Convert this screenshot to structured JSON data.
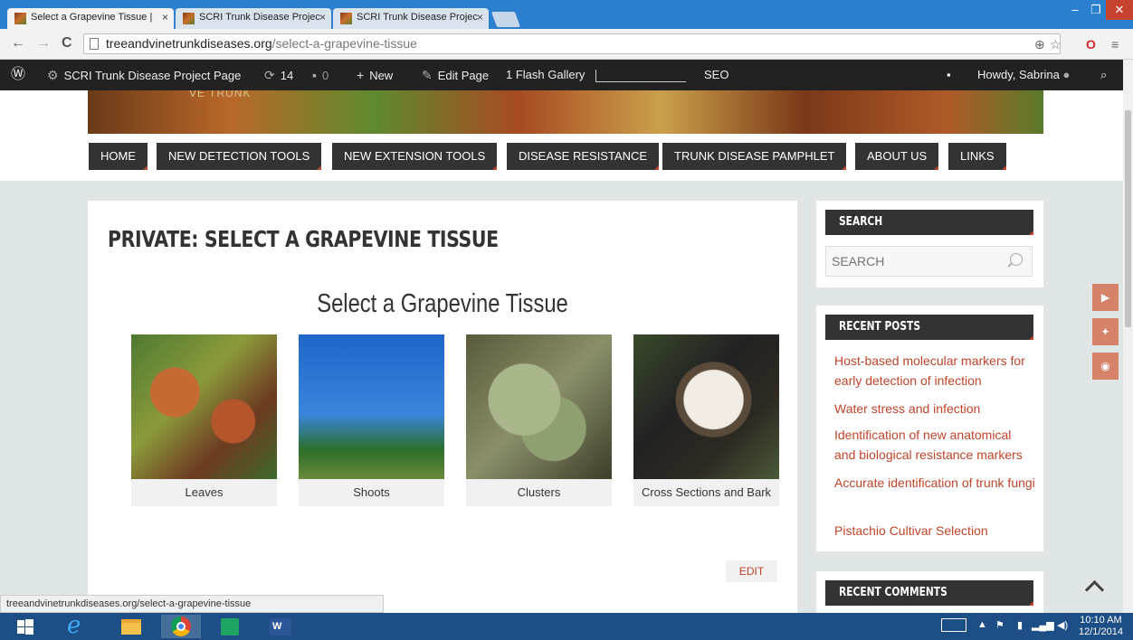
{
  "browser": {
    "tabs": [
      {
        "label": "Select a Grapevine Tissue |"
      },
      {
        "label": "SCRI Trunk Disease Projec"
      },
      {
        "label": "SCRI Trunk Disease Projec"
      }
    ],
    "url_domain": "treeandvinetrunkdiseases.org",
    "url_path": "/select-a-grapevine-tissue",
    "status_url": "treeandvinetrunkdiseases.org/select-a-grapevine-tissue"
  },
  "adminbar": {
    "site_name": "SCRI Trunk Disease Project Page",
    "updates_count": "14",
    "comments_count": "0",
    "new_label": "New",
    "edit_label": "Edit Page",
    "flash_gallery": "1 Flash Gallery",
    "seo_label": "SEO",
    "howdy": "Howdy, Sabrina"
  },
  "site": {
    "banner_text": "VE TRUNK",
    "menu": [
      {
        "label": "HOME"
      },
      {
        "label": "NEW DETECTION TOOLS"
      },
      {
        "label": "NEW EXTENSION TOOLS"
      },
      {
        "label": "DISEASE RESISTANCE"
      },
      {
        "label": "TRUNK DISEASE PAMPHLET"
      },
      {
        "label": "ABOUT US"
      },
      {
        "label": "LINKS"
      }
    ]
  },
  "main": {
    "page_title": "PRIVATE: SELECT A GRAPEVINE TISSUE",
    "section_title": "Select a Grapevine Tissue",
    "tiles": [
      {
        "caption": "Leaves"
      },
      {
        "caption": "Shoots"
      },
      {
        "caption": "Clusters"
      },
      {
        "caption": "Cross Sections and Bark"
      }
    ],
    "edit_label": "EDIT"
  },
  "sidebar": {
    "search_title": "SEARCH",
    "search_placeholder": "SEARCH",
    "recent_posts_title": "RECENT POSTS",
    "recent_posts": [
      {
        "title": "Host-based molecular markers for early detection of infection"
      },
      {
        "title": "Water stress and infection"
      },
      {
        "title": "Identification of new anatomical and biological resistance markers"
      },
      {
        "title": "Accurate identification of trunk fungi"
      },
      {
        "title": "Pistachio Cultivar Selection"
      }
    ],
    "recent_comments_title": "RECENT COMMENTS"
  },
  "taskbar": {
    "time": "10:10 AM",
    "date": "12/1/2014"
  },
  "colors": {
    "accent": "#c0442a",
    "menu_bg": "#333333",
    "page_bg": "#dfe6e5",
    "adminbar_bg": "#222222",
    "taskbar_bg": "#1d4f86"
  }
}
